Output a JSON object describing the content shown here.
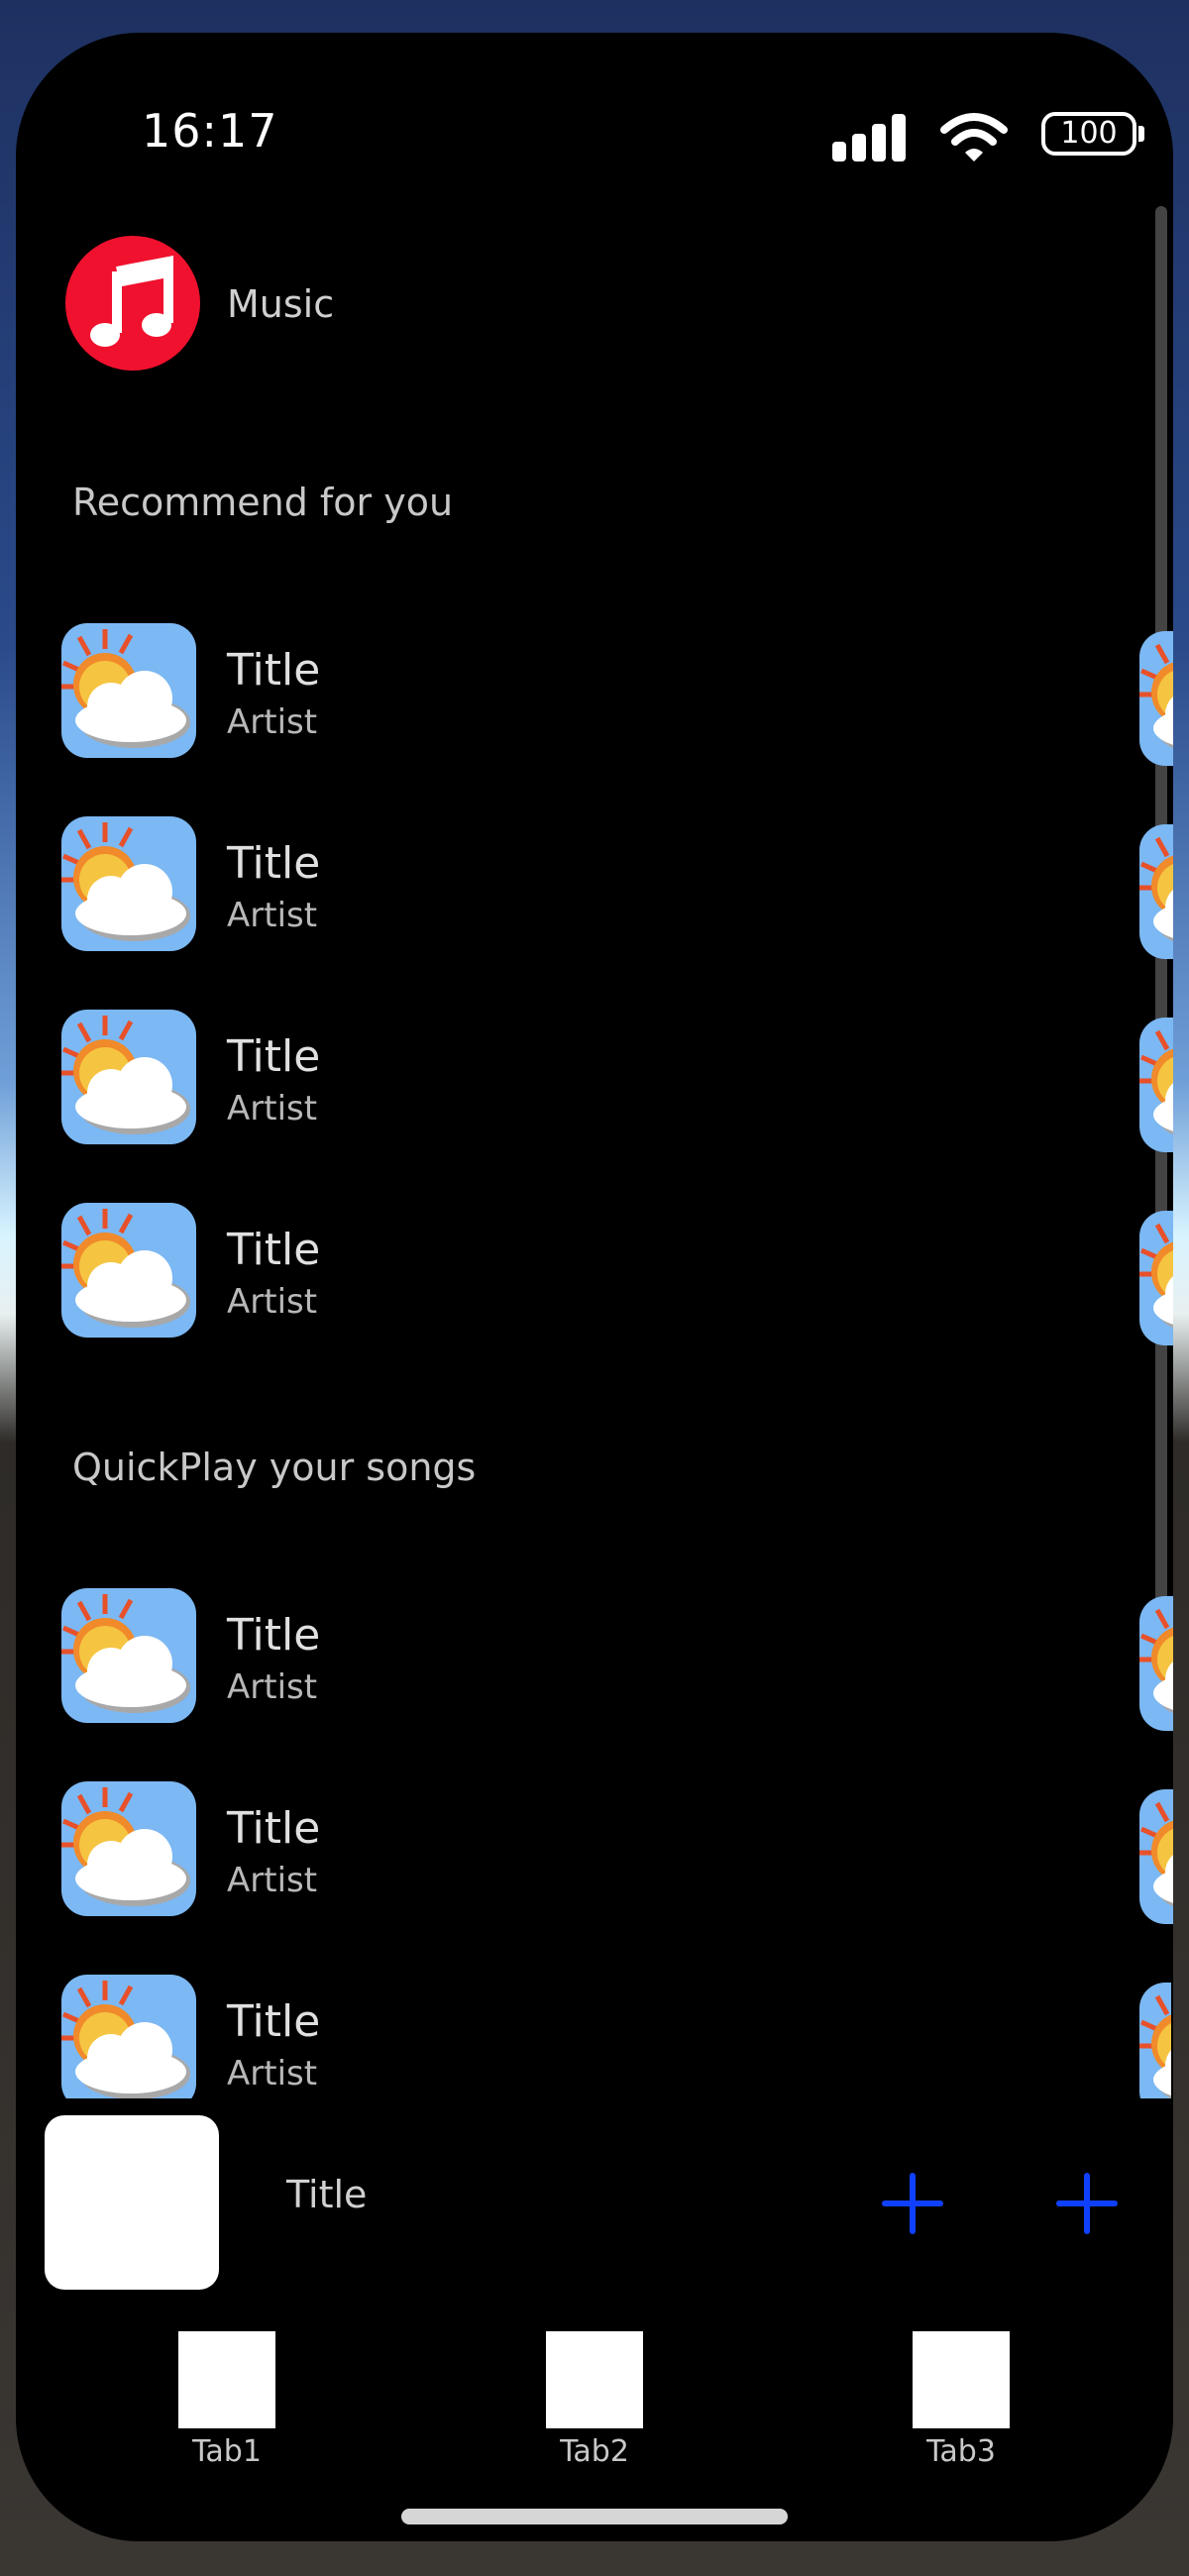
{
  "status": {
    "time": "16:17",
    "battery": "100"
  },
  "app": {
    "name": "Music",
    "icon": "music-note-icon",
    "accent": "#f0112e"
  },
  "sections": [
    {
      "title": "Recommend for you"
    },
    {
      "title": "QuickPlay your songs"
    }
  ],
  "recommended": [
    {
      "title": "Title",
      "artist": "Artist",
      "artwork": "partly-cloudy-icon"
    },
    {
      "title": "Title",
      "artist": "Artist",
      "artwork": "partly-cloudy-icon"
    },
    {
      "title": "Title",
      "artist": "Artist",
      "artwork": "partly-cloudy-icon"
    },
    {
      "title": "Title",
      "artist": "Artist",
      "artwork": "partly-cloudy-icon"
    }
  ],
  "quickplay": [
    {
      "title": "Title",
      "artist": "Artist",
      "artwork": "partly-cloudy-icon"
    },
    {
      "title": "Title",
      "artist": "Artist",
      "artwork": "partly-cloudy-icon"
    },
    {
      "title": "Title",
      "artist": "Artist",
      "artwork": "partly-cloudy-icon"
    }
  ],
  "mini_player": {
    "title": "Title",
    "button_color": "#1040ff"
  },
  "tabs": [
    {
      "label": "Tab1"
    },
    {
      "label": "Tab2"
    },
    {
      "label": "Tab3"
    }
  ]
}
